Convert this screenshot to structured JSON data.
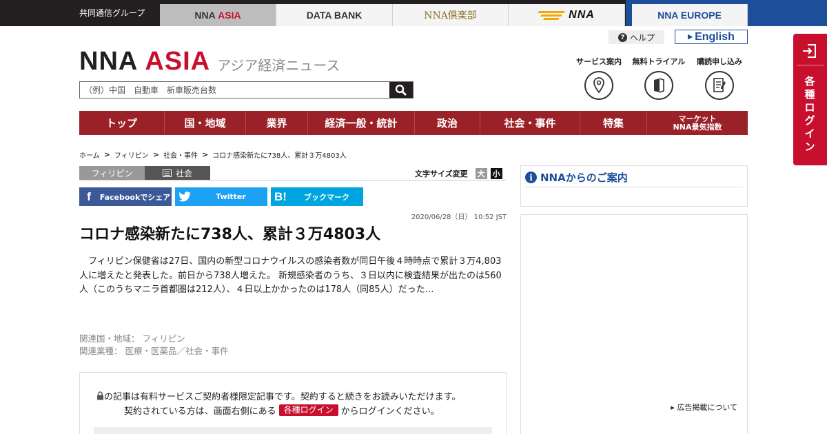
{
  "topbar": {
    "group": "共同通信グループ",
    "tabs": [
      {
        "pre": "NNA ",
        "red": "ASIA"
      },
      {
        "label": "DATA BANK"
      },
      {
        "label": "NNA倶楽部"
      },
      {
        "label": "NNA"
      },
      {
        "label": "NNA EUROPE"
      }
    ]
  },
  "header": {
    "brand_a": "NNA",
    "brand_b": "ASIA",
    "brand_sub": "アジア経済ニュース",
    "help": "ヘルプ",
    "english": "English",
    "services": [
      "サービス案内",
      "無料トライアル",
      "購読申し込み"
    ],
    "search_placeholder": "（例）中国　自動車　新車販売台数"
  },
  "nav": [
    "トップ",
    "国・地域",
    "業界",
    "経済一般・統計",
    "政治",
    "社会・事件",
    "特集"
  ],
  "nav_market": {
    "line1": "マーケット",
    "line2": "NNA景気指数"
  },
  "login": {
    "label": "各種ログイン"
  },
  "breadcrumb": [
    "ホーム",
    "フィリピン",
    "社会・事件",
    "コロナ感染新たに738人、累計３万4803人"
  ],
  "tags": {
    "country": "フィリピン",
    "category": "社会"
  },
  "font_size": {
    "label": "文字サイズ変更",
    "big": "大",
    "small": "小"
  },
  "share": {
    "facebook": "Facebookでシェア",
    "twitter": "Twitter",
    "hatena": "ブックマーク",
    "hatena_icon": "B!"
  },
  "article": {
    "date": "2020/06/28（日） 10:52 JST",
    "title": "コロナ感染新たに738人、累計３万4803人",
    "body": "フィリピン保健省は27日、国内の新型コロナウイルスの感染者数が同日午後４時時点で累計３万4,803人に増えたと発表した。前日から738人増えた。 新規感染者のうち、３日以内に検査結果が出たのは560人（このうちマニラ首都圏は212人）、４日以上かかったのは178人（同85人）だった…",
    "related_country": "関連国・地域： フィリピン",
    "related_industry": "関連業種： 医療・医薬品／社会・事件"
  },
  "paywall": {
    "line1": "の記事は有料サービスご契約者様限定記事です。契約すると続きをお読みいただけます。",
    "line2_pre": "契約されている方は、画面右側にある",
    "line2_badge": "各種ログイン",
    "line2_post": "からログインください。"
  },
  "sidebar": {
    "info_title": "NNAからのご案内",
    "ad_link": "広告掲載について"
  },
  "icons": [
    "help-icon",
    "map-pin-icon",
    "book-icon",
    "document-icon",
    "search-icon",
    "login-icon",
    "lock-icon",
    "list-icon",
    "facebook-icon",
    "twitter-icon",
    "hatena-icon",
    "info-icon"
  ],
  "colors": {
    "brand_red": "#c8102e",
    "nav_red": "#9b2128",
    "blue": "#1d4e9a",
    "dark": "#231f20"
  }
}
